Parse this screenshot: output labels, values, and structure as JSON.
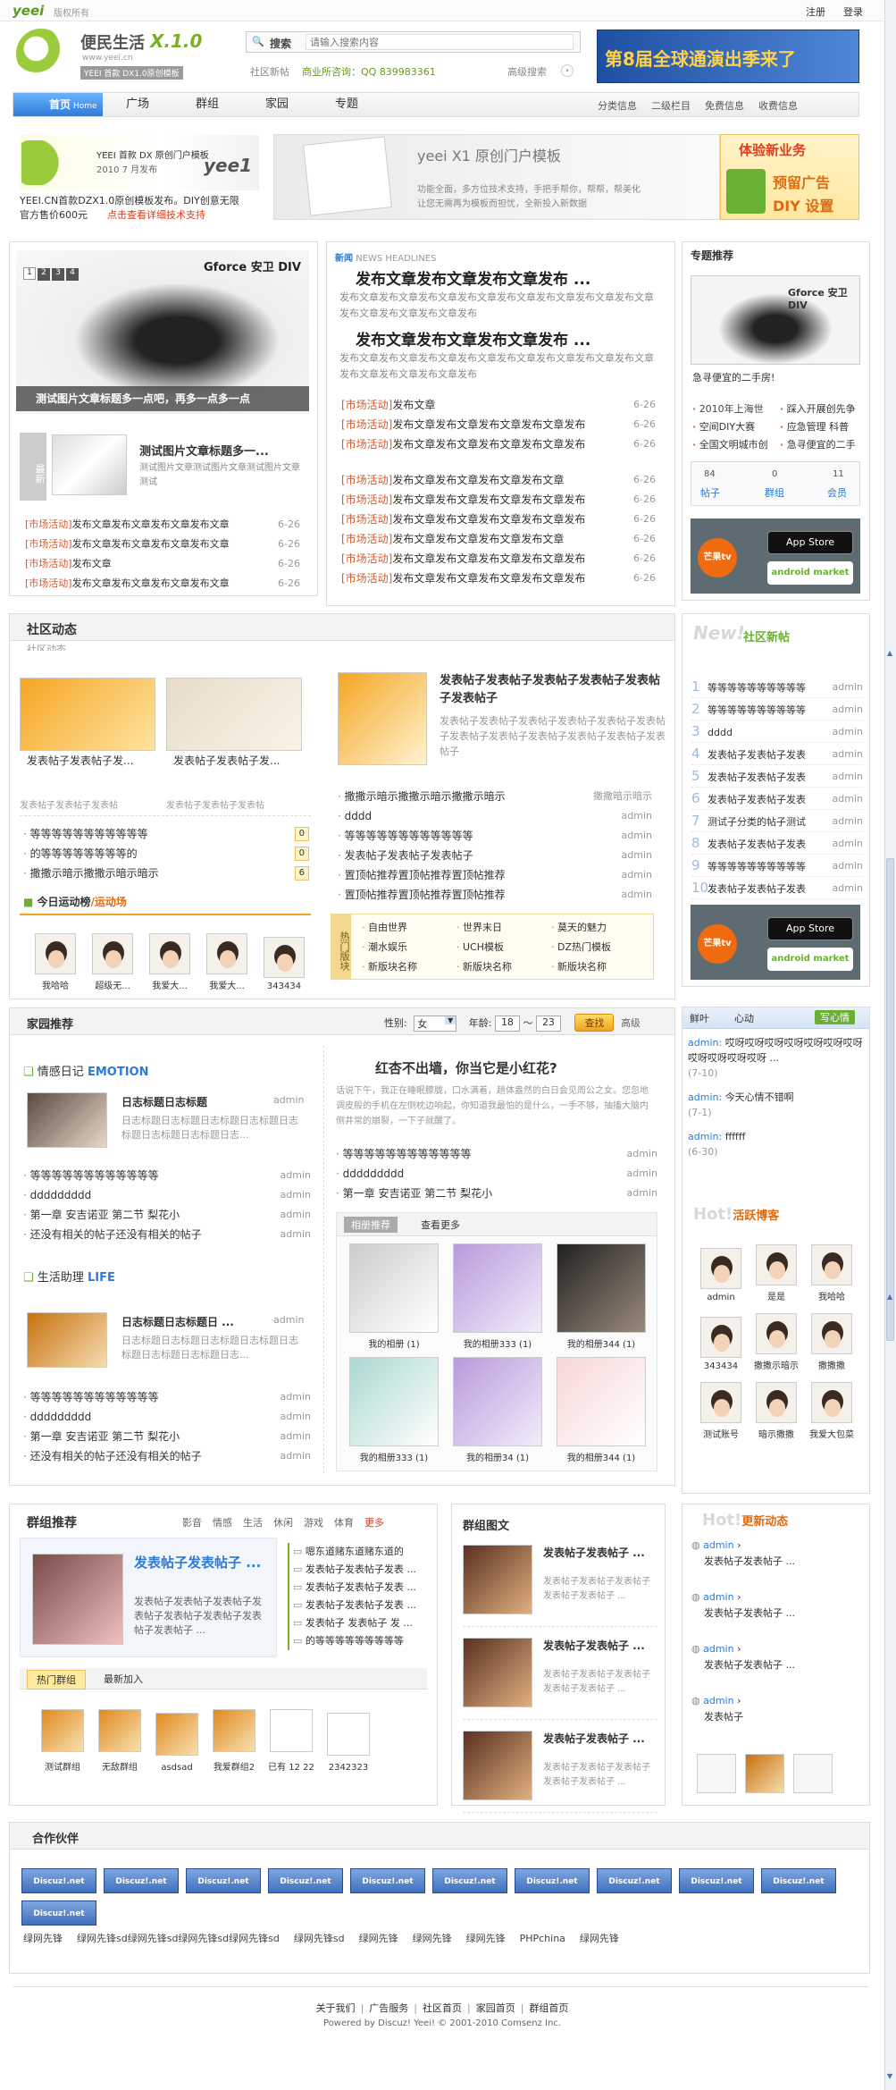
{
  "header": {
    "logo_text": "yeei",
    "logo_sub": "版权所有",
    "links": [
      "注册",
      "登录"
    ]
  },
  "brand": {
    "title": "便民生活",
    "ver": "X.1.0",
    "url": "www.yeei.cn",
    "slogan": "YEEI 首款 DX1.0原创模板"
  },
  "search": {
    "label": "搜索",
    "placeholder": "请输入搜索内容",
    "sub_link": "社区新帖",
    "business": "商业所咨询：QQ 839983361",
    "adv": "高级搜索"
  },
  "ad_top": {
    "text": "第8届全球通演出季来了"
  },
  "nav": {
    "tabs": [
      "首页",
      "广场",
      "群组",
      "家园",
      "专题"
    ],
    "home_sub": "Home",
    "right": [
      "分类信息",
      "二级栏目",
      "免费信息",
      "收费信息"
    ]
  },
  "promo": {
    "left_text1": "YEEI 首款 DX 原创门户模板",
    "left_text2": "2010 7 月发布",
    "left_brand": "yee1",
    "caption1": "YEEI.CN首款DZX1.0原创模板发布。DIY创意无限",
    "caption2": "官方售价600元",
    "caption_link": "点击查看详细技术支持",
    "mid_title": "yeei X1 原创门户模板",
    "mid_desc1": "功能全面，多方位技术支持，手把手帮你，帮帮，帮美化",
    "mid_desc2": "让您无需再为模板而担忧，全新投入新数据",
    "right_text1": "体验新业务",
    "right_text2": "预留广告",
    "right_text3": "DIY 设置"
  },
  "slider": {
    "pages": [
      "1",
      "2",
      "3",
      "4"
    ],
    "caption": "测试图片文章标题多一点吧，再多一点多一点",
    "brand": "Gforce 安卫 DIV"
  },
  "feature": {
    "tag": "最新",
    "title": "测试图片文章标题多一...",
    "desc": "测试图片文章测试图片文章测试图片文章测试"
  },
  "left_list": [
    {
      "c": "[市场活动]",
      "t": "发布文章发布文章发布文章发布文章",
      "d": "6-26"
    },
    {
      "c": "[市场活动]",
      "t": "发布文章发布文章发布文章发布文章",
      "d": "6-26"
    },
    {
      "c": "[市场活动]",
      "t": "发布文章",
      "d": "6-26"
    },
    {
      "c": "[市场活动]",
      "t": "发布文章发布文章发布文章发布文章",
      "d": "6-26"
    }
  ],
  "headline": {
    "label": "新闻",
    "sub": "NEWS HEADLINES",
    "items": [
      {
        "title": "发布文章发布文章发布文章发布 ...",
        "desc": "发布文章发布文章发布文章发布文章发布文章发布文章发布文章发布文章发布文章发布文章发布文章发布"
      },
      {
        "title": "发布文章发布文章发布文章发布 ...",
        "desc": "发布文章发布文章发布文章发布文章发布文章发布文章发布文章发布文章发布文章发布文章发布文章发布"
      }
    ]
  },
  "mid_list1": [
    {
      "c": "[市场活动]",
      "t": "发布文章",
      "d": "6-26"
    },
    {
      "c": "[市场活动]",
      "t": "发布文章发布文章发布文章发布文章发布",
      "d": "6-26"
    },
    {
      "c": "[市场活动]",
      "t": "发布文章发布文章发布文章发布文章发布",
      "d": "6-26"
    }
  ],
  "mid_list2": [
    {
      "c": "[市场活动]",
      "t": "发布文章发布文章发布文章发布文章",
      "d": "6-26"
    },
    {
      "c": "[市场活动]",
      "t": "发布文章发布文章发布文章发布文章发布",
      "d": "6-26"
    },
    {
      "c": "[市场活动]",
      "t": "发布文章发布文章发布文章发布文章发布",
      "d": "6-26"
    },
    {
      "c": "[市场活动]",
      "t": "发布文章发布文章发布文章发布文章",
      "d": "6-26"
    },
    {
      "c": "[市场活动]",
      "t": "发布文章发布文章发布文章发布文章发布",
      "d": "6-26"
    },
    {
      "c": "[市场活动]",
      "t": "发布文章发布文章发布文章发布文章发布",
      "d": "6-26"
    }
  ],
  "special": {
    "title": "专题推荐",
    "brand": "Gforce 安卫 DIV",
    "caption": "急寻便宜的二手房!",
    "links": [
      "2010年上海世",
      "踩入开展创先争",
      "空间DIY大赛",
      "应急管理 科普",
      "全国文明城市创",
      "急寻便宜的二手"
    ],
    "stats": [
      {
        "n": "84",
        "l": "帖子"
      },
      {
        "n": "0",
        "l": "群组"
      },
      {
        "n": "11",
        "l": "会员"
      }
    ]
  },
  "app": {
    "brand": "芒果tv",
    "store": "App Store",
    "store_sub": "Available on the iPhone",
    "market": "android market"
  },
  "community": {
    "title": "社区动态",
    "subtitle": "社区动态",
    "thumbs": [
      {
        "t": "发表帖子发表帖子发...",
        "d": "发表帖子发表帖子发表帖"
      },
      {
        "t": "发表帖子发表帖子发...",
        "d": "发表帖子发表帖子发表帖"
      }
    ],
    "list": [
      {
        "t": "等等等等等等等等等等等",
        "n": "0"
      },
      {
        "t": "的等等等等等等等等的",
        "n": "0"
      },
      {
        "t": "撒撒示暗示撒撒示暗示暗示",
        "n": "6"
      }
    ],
    "rank_title": "今日运动榜",
    "rank_sub": "/运动场",
    "users": [
      "我哈哈",
      "超级无...",
      "我爱大...",
      "我爱大...",
      "343434"
    ],
    "feat_title": "发表帖子发表帖子发表帖子发表帖子发表帖子发表帖子",
    "feat_desc": "发表帖子发表帖子发表帖子发表帖子发表帖子发表帖子发表帖子发表帖子发表帖子发表帖子发表帖子发表帖子",
    "rlist": [
      {
        "t": "撒撒示暗示撒撒示暗示撒撒示暗示",
        "a": "撒撒暗示暗示"
      },
      {
        "t": "dddd",
        "a": "admin"
      },
      {
        "t": "等等等等等等等等等等等等",
        "a": "admin"
      },
      {
        "t": "发表帖子发表帖子发表帖子",
        "a": "admin"
      },
      {
        "t": "置顶帖推荐置顶帖推荐置顶帖推荐",
        "a": "admin"
      },
      {
        "t": "置顶帖推荐置顶帖推荐置顶帖推荐",
        "a": "admin"
      }
    ],
    "hot_label": "热门版块",
    "forums": [
      "自由世界",
      "世界末日",
      "莫天的魅力",
      "潮水娱乐",
      "UCH模板",
      "DZ热门模板",
      "新版块名称",
      "新版块名称",
      "新版块名称"
    ]
  },
  "newpost": {
    "title": "社区新帖",
    "ttl_en": "New!",
    "items": [
      {
        "n": "1",
        "t": "等等等等等等等等等等",
        "a": "admin"
      },
      {
        "n": "2",
        "t": "等等等等等等等等等等",
        "a": "admin"
      },
      {
        "n": "3",
        "t": "dddd",
        "a": "admin"
      },
      {
        "n": "4",
        "t": "发表帖子发表帖子发表",
        "a": "admin"
      },
      {
        "n": "5",
        "t": "发表帖子发表帖子发表",
        "a": "admin"
      },
      {
        "n": "6",
        "t": "发表帖子发表帖子发表",
        "a": "admin"
      },
      {
        "n": "7",
        "t": "测试子分类的帖子测试",
        "a": "admin"
      },
      {
        "n": "8",
        "t": "发表帖子发表帖子发表",
        "a": "admin"
      },
      {
        "n": "9",
        "t": "等等等等等等等等等等",
        "a": "admin"
      },
      {
        "n": "10",
        "t": "发表帖子发表帖子发表",
        "a": "admin"
      }
    ]
  },
  "home": {
    "title": "家园推荐",
    "gender_label": "性别:",
    "gender": "女",
    "age_label": "年龄:",
    "age_from": "18",
    "age_sep": "～",
    "age_to": "23",
    "find": "查找",
    "adv": "高级",
    "diary_title": "情感日记",
    "diary_en": "EMOTION",
    "life_title": "生活助理",
    "life_en": "LIFE",
    "blog_title": "日志标题日志标题",
    "blog_desc": "日志标题日志标题日志标题日志标题日志标题日志标题日志标题日志...",
    "blog2_title": "日志标题日志标题日 ...",
    "blist": [
      {
        "t": "等等等等等等等等等等等等",
        "a": "admin"
      },
      {
        "t": "ddddddddd",
        "a": "admin"
      },
      {
        "t": "第一章 安吉诺亚 第二节 梨花小",
        "a": "admin"
      },
      {
        "t": "还没有相关的帖子还没有相关的帖子",
        "a": "admin"
      }
    ],
    "quote_title": "红杏不出墙，你当它是小红花?",
    "quote_text": "话说下午，我正在睡眠朦胧，口水满着，趟体盎然的白日会见周公之女。您忽地调皮般的手机在左侧枕边响起，你知道我最怕的是什么，一手不够，抽搐大脑内侧井常的崩裂，一下子就醒了。",
    "clist": [
      {
        "t": "等等等等等等等等等等等等",
        "a": "admin"
      },
      {
        "t": "ddddddddd",
        "a": "admin"
      },
      {
        "t": "第一章 安吉诺亚 第二节 梨花小",
        "a": "admin"
      }
    ],
    "album_tabs": [
      "相册推荐",
      "查看更多"
    ],
    "albums": [
      "我的相册 (1)",
      "我的相册333 (1)",
      "我的相册344 (1)",
      "我的相册333 (1)",
      "我的相册34 (1)",
      "我的相册344 (1)"
    ]
  },
  "mood": {
    "tab1": "鲜叶",
    "tab2": "心动",
    "btn": "写心情",
    "items": [
      {
        "a": "admin:",
        "t": "哎呀哎呀哎呀哎呀哎呀哎呀哎呀哎呀哎呀哎呀哎呀 ...",
        "d": "(7-10)"
      },
      {
        "a": "admin:",
        "t": "今天心情不错啊",
        "d": "(7-1)"
      },
      {
        "a": "admin:",
        "t": "ffffff",
        "d": "(6-30)"
      }
    ]
  },
  "active": {
    "title": "活跃博客",
    "ttl_en": "Hot!",
    "users": [
      "admin",
      "是是",
      "我哈哈",
      "343434",
      "撒撒示暗示",
      "撒撒撒",
      "测试账号",
      "暗示撒撒",
      "我爱大包菜"
    ]
  },
  "group": {
    "title": "群组推荐",
    "tags": [
      "影音",
      "情感",
      "生活",
      "休闲",
      "游戏",
      "体育"
    ],
    "more": "更多",
    "feat_title": "发表帖子发表帖子 ...",
    "feat_desc": "发表帖子发表帖子发表帖子发表帖子发表帖子发表帖子发表帖子发表帖子 ...",
    "links": [
      "嗯东道赌东道赌东道的",
      "发表帖子发表帖子发表 ...",
      "发表帖子发表帖子发表 ...",
      "发表帖子发表帖子发表 ...",
      "发表帖子 发表帖子 发 ...",
      "的等等等等等等等等等"
    ],
    "tabs": [
      "热门群组",
      "最新加入"
    ],
    "groups": [
      "测试群组",
      "无敌群组",
      "asdsad",
      "我爱群组2",
      "已有 12 22",
      "2342323"
    ]
  },
  "gpic": {
    "title": "群组图文",
    "items": [
      {
        "t": "发表帖子发表帖子 ...",
        "d": "发表帖子发表帖子发表帖子发表帖子发表帖子 ..."
      },
      {
        "t": "发表帖子发表帖子 ...",
        "d": "发表帖子发表帖子发表帖子发表帖子发表帖子 ..."
      },
      {
        "t": "发表帖子发表帖子 ...",
        "d": "发表帖子发表帖子发表帖子发表帖子发表帖子 ..."
      }
    ]
  },
  "updates": {
    "title": "更新动态",
    "ttl_en": "Hot!",
    "items": [
      {
        "a": "admin",
        "t": "发表帖子发表帖子 ..."
      },
      {
        "a": "admin",
        "t": "发表帖子发表帖子 ..."
      },
      {
        "a": "admin",
        "t": "发表帖子发表帖子 ..."
      },
      {
        "a": "admin",
        "t": "发表帖子"
      }
    ]
  },
  "partners": {
    "title": "合作伙伴",
    "logo": "Discuz!.net",
    "links": [
      "绿网先锋",
      "绿网先锋sd绿网先锋sd绿网先锋sd绿网先锋sd",
      "绿网先锋sd",
      "绿网先锋",
      "绿网先锋",
      "绿网先锋",
      "PHPchina",
      "绿网先锋"
    ]
  },
  "footer": {
    "links": [
      "关于我们",
      "广告服务",
      "社区首页",
      "家园首页",
      "群组首页"
    ],
    "copy": "Powered by Discuz! Yeei! © 2001-2010 Comsenz Inc."
  }
}
